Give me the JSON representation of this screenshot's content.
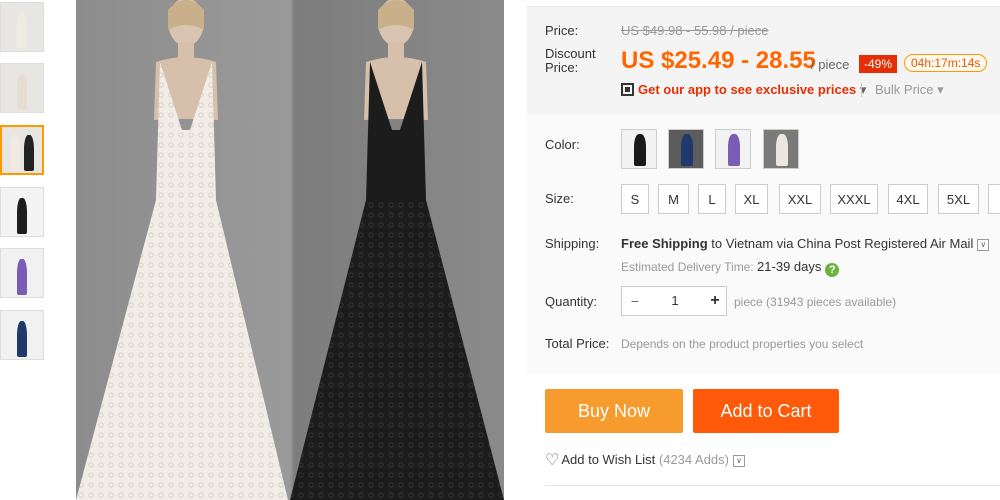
{
  "thumbnails": [
    {
      "label": "white-dress-thumb",
      "colors": [
        "#efeae2"
      ]
    },
    {
      "label": "white-dress-thumb-2",
      "colors": [
        "#e9e4da"
      ]
    },
    {
      "label": "white-black-dress-thumb",
      "colors": [
        "#efeae2",
        "#222"
      ],
      "active": true
    },
    {
      "label": "black-dress-thumb",
      "colors": [
        "#1e1e1e"
      ]
    },
    {
      "label": "purple-dress-thumb",
      "colors": [
        "#7a5bb5"
      ]
    },
    {
      "label": "navy-dress-thumb",
      "colors": [
        "#1f3a6a"
      ]
    }
  ],
  "price": {
    "label": "Price:",
    "original": "US $49.98 - 55.98 / piece",
    "discount_label_1": "Discount",
    "discount_label_2": "Price:",
    "discount_value": "US $25.49 - 28.55",
    "per_unit": "/ piece",
    "discount_percent": "-49%",
    "timer": "04h:17m:14s",
    "app_link": "Get our app to see exclusive prices",
    "app_caret": "▾",
    "bulk": "Bulk Price",
    "bulk_caret": "▾"
  },
  "color": {
    "label": "Color:",
    "swatches": [
      "#1a1a1a",
      "#1f3a6a",
      "#7a5bb5",
      "#ece7de"
    ]
  },
  "size": {
    "label": "Size:",
    "options": [
      "S",
      "M",
      "L",
      "XL",
      "XXL",
      "XXXL",
      "4XL",
      "5XL"
    ]
  },
  "shipping": {
    "label": "Shipping:",
    "free": "Free Shipping",
    "rest": " to Vietnam via China Post Registered Air Mail",
    "caret": "∨",
    "est_label": "Estimated Delivery Time: ",
    "est_days": "21-39  days",
    "help": "?"
  },
  "quantity": {
    "label": "Quantity:",
    "minus": "−",
    "value": "1",
    "plus": "+",
    "available": "piece (31943 pieces available)"
  },
  "total": {
    "label": "Total Price:",
    "value": "Depends on the product properties you select"
  },
  "actions": {
    "buy_now": "Buy Now",
    "add_to_cart": "Add to Cart",
    "wish_heart": "♡",
    "wish_label": "Add to Wish List ",
    "wish_count": "(4234 Adds)",
    "wish_caret": "∨"
  },
  "colors": {
    "discount_orange": "#ff6600",
    "badge_red": "#e62e04",
    "buy_now_bg": "#f89b2e",
    "add_to_cart_bg": "#ff5a0a"
  }
}
